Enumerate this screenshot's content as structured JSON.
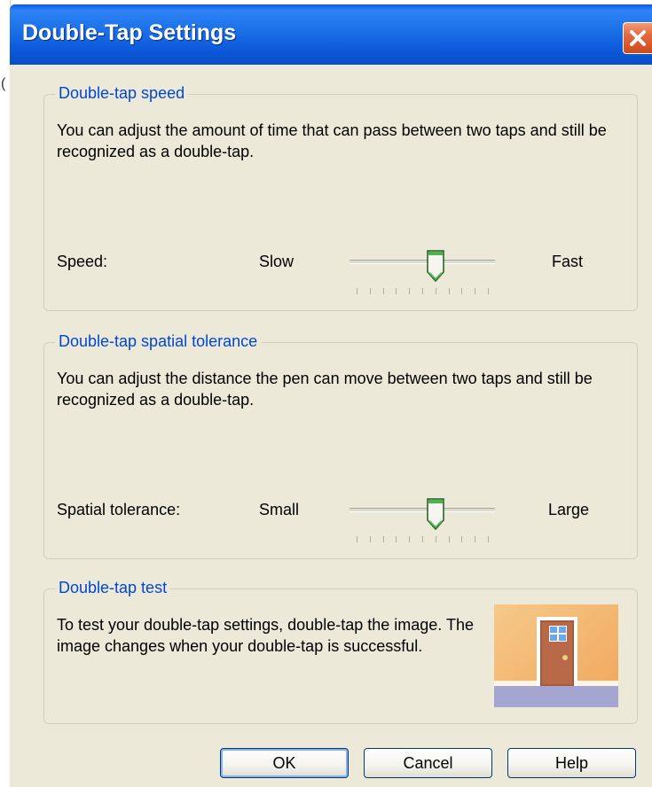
{
  "background": {
    "edge_glyph": "("
  },
  "window": {
    "title": "Double-Tap Settings",
    "accent": "#0a5ce8",
    "close_icon": "close-icon"
  },
  "speed_group": {
    "legend": "Double-tap speed",
    "description": "You can adjust the amount of time that can pass between two taps and still be recognized as a double-tap.",
    "label": "Speed:",
    "min_label": "Slow",
    "max_label": "Fast",
    "value": 6,
    "tick_count": 11
  },
  "tolerance_group": {
    "legend": "Double-tap spatial tolerance",
    "description": "You can adjust the distance the pen can move between two taps and still be recognized as a double-tap.",
    "label": "Spatial tolerance:",
    "min_label": "Small",
    "max_label": "Large",
    "value": 6,
    "tick_count": 11
  },
  "test_group": {
    "legend": "Double-tap test",
    "description": "To test your double-tap settings, double-tap the image. The image changes when your double-tap is successful.",
    "image_icon": "door-icon"
  },
  "buttons": {
    "ok": "OK",
    "cancel": "Cancel",
    "help": "Help"
  }
}
